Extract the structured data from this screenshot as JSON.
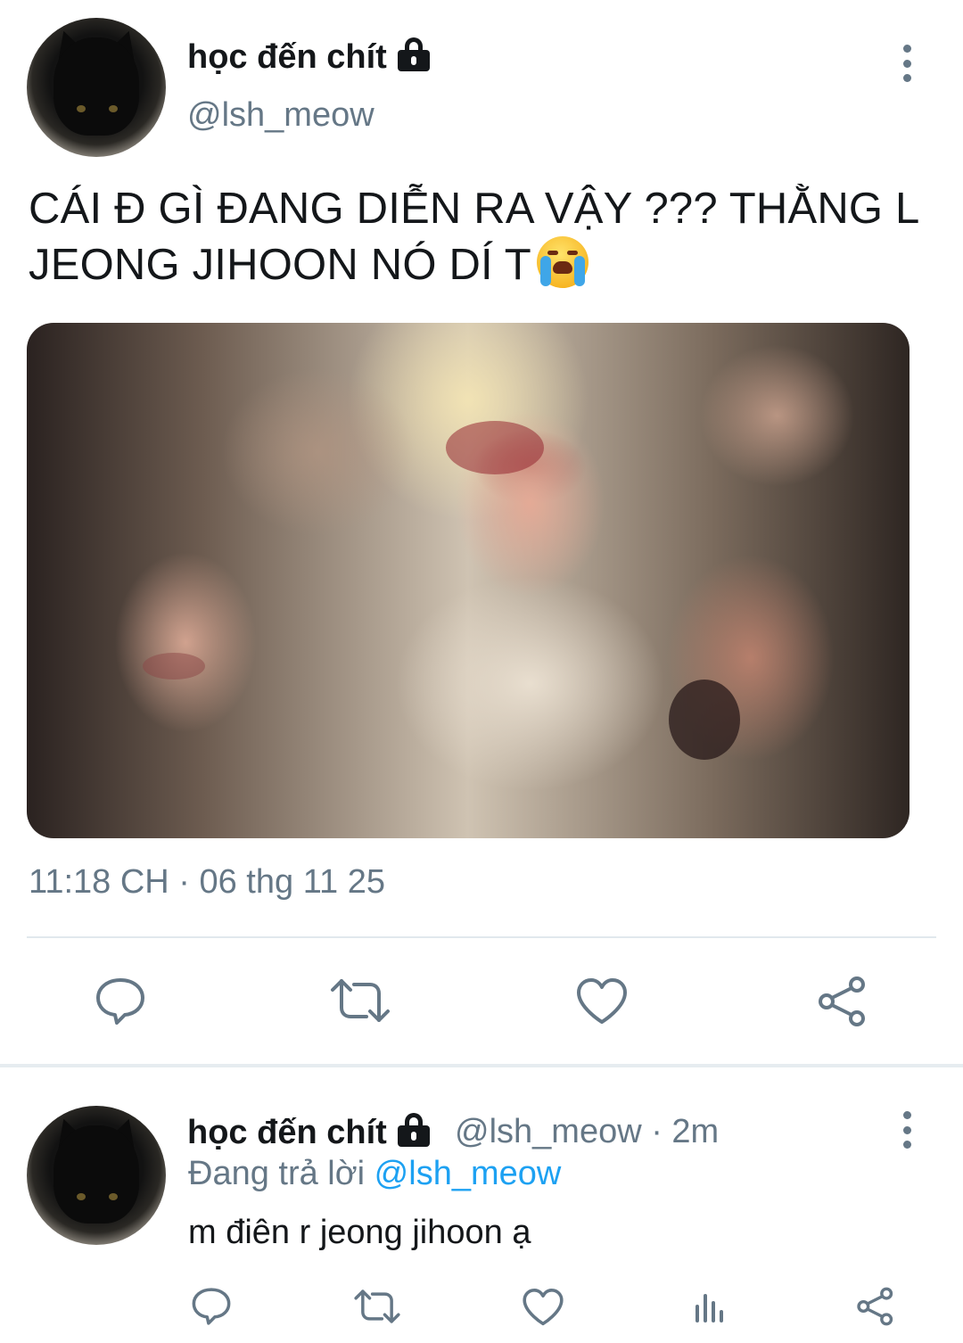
{
  "main_tweet": {
    "display_name": "học đến chít",
    "handle": "@lsh_meow",
    "text_line1": "CÁI Đ GÌ ĐANG DIỄN RA VẬY ??? THẰNG L",
    "text_line2": "JEONG JIHOON NÓ DÍ T",
    "emoji": "loudly-crying-face",
    "timestamp": "11:18 CH · 06 thg 11 25",
    "media": "crying-faces-collage-photo"
  },
  "main_actions": [
    "reply-icon",
    "retweet-icon",
    "like-icon",
    "share-icon"
  ],
  "reply_tweet": {
    "display_name": "học đến chít",
    "handle_time": "@lsh_meow · 2m",
    "replying_prefix": "Đang trả lời ",
    "replying_mention": "@lsh_meow",
    "text": "m điên r jeong jihoon ạ"
  },
  "reply_actions": [
    "reply-icon",
    "retweet-icon",
    "like-icon",
    "analytics-icon",
    "share-icon"
  ],
  "colors": {
    "text": "#14171a",
    "secondary": "#657786",
    "link": "#1da1f2",
    "divider": "#e1e8ed"
  }
}
